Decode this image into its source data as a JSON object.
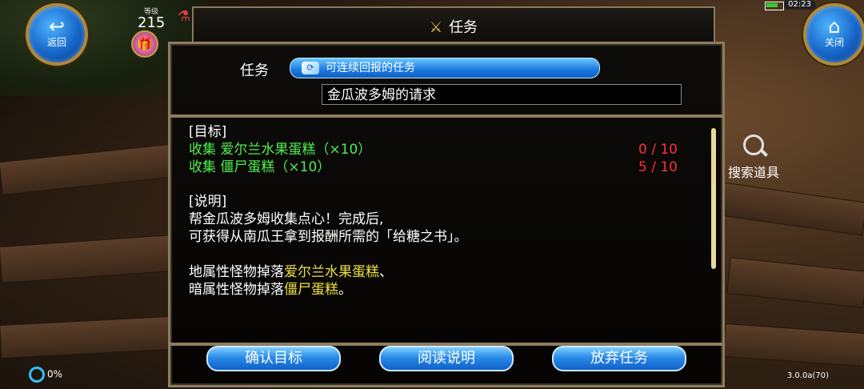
{
  "hud": {
    "back_label": "返回",
    "close_label": "关闭",
    "level_caption": "等级",
    "level": "215",
    "clock": "02:23",
    "progress_percent": "0%",
    "version": "3.0.0a(70)"
  },
  "dialog": {
    "title": "任务",
    "task_field_label": "任务",
    "task_type": "可连续回报的任务",
    "task_name": "金瓜波多姆的请求",
    "objective_header": "[目标]",
    "objectives": [
      {
        "text": "收集 爱尔兰水果蛋糕（×10）",
        "progress": "0 / 10"
      },
      {
        "text": "收集 僵尸蛋糕（×10）",
        "progress": "5 / 10"
      }
    ],
    "description_header": "[说明]",
    "description_line1": "帮金瓜波多姆收集点心！完成后,",
    "description_line2": "可获得从南瓜王拿到报酬所需的「给糖之书」。",
    "drop_line1_prefix": "地属性怪物掉落",
    "drop_line1_item": "爱尔兰水果蛋糕",
    "drop_line1_suffix": "、",
    "drop_line2_prefix": "暗属性怪物掉落",
    "drop_line2_item": "僵尸蛋糕",
    "drop_line2_suffix": "。",
    "buttons": {
      "confirm": "确认目标",
      "read": "阅读说明",
      "abandon": "放弃任务"
    }
  },
  "search": {
    "label": "搜索道具"
  },
  "colors": {
    "objective_text": "#4ff04f",
    "item_highlight": "#f0e040",
    "progress_text": "#ff3030",
    "button_blue": "#2a8ae8"
  }
}
